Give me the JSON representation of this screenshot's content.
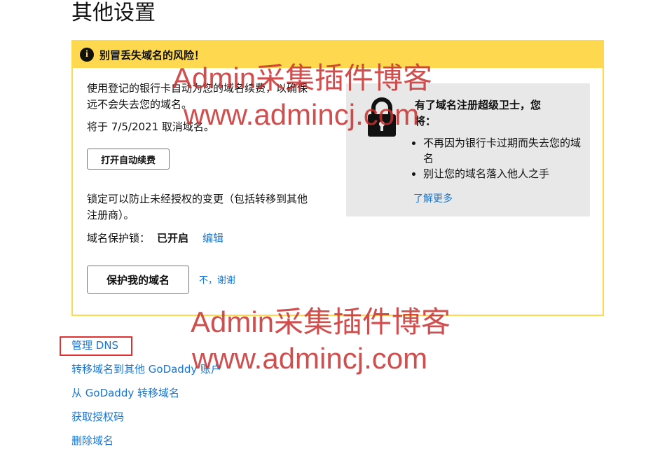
{
  "page": {
    "title": "其他设置"
  },
  "warning": {
    "title": "别冒丢失域名的风险！",
    "auto_renew_text_line1": "使用登记的银行卡自动为您的域名续费，以确保",
    "auto_renew_text_line2": "远不会失去您的域名。",
    "cancel_date_text": "将于 7/5/2021 取消域名。",
    "auto_renew_button": "打开自动续费",
    "lock_text_line1": "锁定可以防止未经授权的变更（包括转移到其他",
    "lock_text_line2": "注册商）。",
    "lock_label": "域名保护锁：",
    "lock_status": "已开启",
    "edit_link": "编辑",
    "protect_button": "保护我的域名",
    "no_thanks_link": "不，谢谢"
  },
  "promo": {
    "title": "有了域名注册超级卫士，您将：",
    "bullets": [
      "不再因为银行卡过期而失去您的域名",
      "别让您的域名落入他人之手"
    ],
    "learn_more": "了解更多"
  },
  "links": {
    "manage_dns": "管理 DNS",
    "transfer_account": "转移域名到其他 GoDaddy 账户",
    "transfer_out": "从 GoDaddy 转移域名",
    "auth_code": "获取授权码",
    "delete_domain": "删除域名"
  },
  "watermark": {
    "line1": "Admin采集插件博客",
    "line2": "www.admincj.com"
  },
  "colors": {
    "accent_yellow": "#fed94f",
    "link_blue": "#1976d2",
    "highlight_red": "#e03030",
    "watermark_red": "#c8302f"
  }
}
